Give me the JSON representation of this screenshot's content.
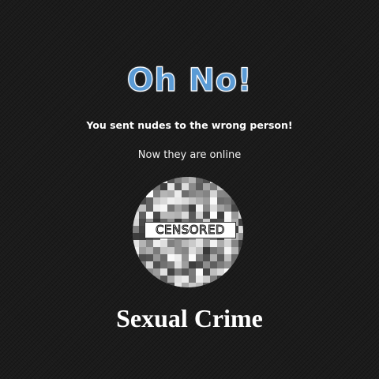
{
  "headline": "Oh No!",
  "subheadline": "You sent nudes to the wrong person!",
  "note": "Now they are online",
  "image": {
    "label": "CENSORED",
    "pixelation": "grayscale-mosaic"
  },
  "footer_title": "Sexual Crime",
  "colors": {
    "background": "#1b1b1b",
    "headline": "#5b9bd5",
    "text": "#ffffff"
  }
}
